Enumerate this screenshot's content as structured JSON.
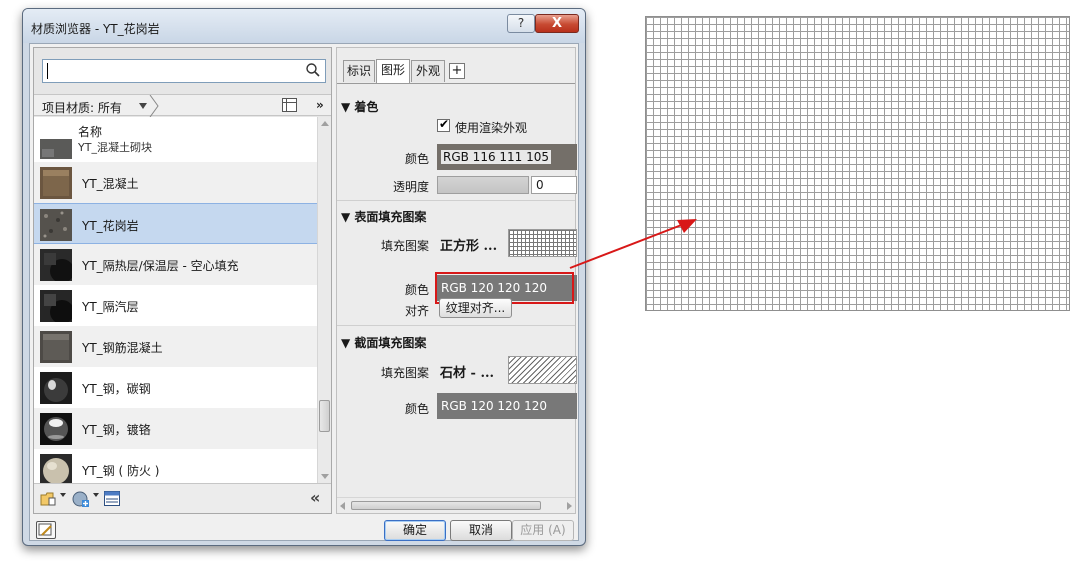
{
  "window": {
    "title": "材质浏览器 - YT_花岗岩",
    "help_label": "?",
    "close_label": "X"
  },
  "search": {
    "placeholder": "",
    "value": ""
  },
  "filter": {
    "label": "项目材质: 所有",
    "more": "»"
  },
  "list": {
    "header_name": "名称",
    "header_partial": "YT_混凝土砌块",
    "items": [
      {
        "label": "YT_混凝土",
        "thumb": "concrete-brown"
      },
      {
        "label": "YT_花岗岩",
        "thumb": "granite",
        "selected": true
      },
      {
        "label": "YT_隔热层/保温层 - 空心填充",
        "thumb": "insulation-dark"
      },
      {
        "label": "YT_隔汽层",
        "thumb": "vapor-dark"
      },
      {
        "label": "YT_钢筋混凝土",
        "thumb": "concrete-gray"
      },
      {
        "label": "YT_钢，碳钢",
        "thumb": "steel-sphere"
      },
      {
        "label": "YT_钢，镀铬",
        "thumb": "chrome-sphere"
      },
      {
        "label": "YT_钢 ( 防火 )",
        "thumb": "fireproof-sphere"
      }
    ]
  },
  "left_toolbar": {
    "collapse_label": "«"
  },
  "tabs": [
    {
      "label": "标识",
      "active": false
    },
    {
      "label": "图形",
      "active": true
    },
    {
      "label": "外观",
      "active": false
    }
  ],
  "tab_add_label": "+",
  "shading": {
    "title": "▼ 着色",
    "use_render_appearance": "使用渲染外观",
    "color_label": "颜色",
    "color_value": "RGB 116 111 105",
    "color_hex": "#746f69",
    "transparency_label": "透明度",
    "transparency_value": "0"
  },
  "surface_pattern": {
    "title": "▼ 表面填充图案",
    "pattern_label": "填充图案",
    "pattern_name": "正方形 ...",
    "color_label": "颜色",
    "color_value": "RGB 120 120 120",
    "align_label": "对齐",
    "align_button": "纹理对齐..."
  },
  "cut_pattern": {
    "title": "▼ 截面填充图案",
    "pattern_label": "填充图案",
    "pattern_name": "石材 - ...",
    "color_label": "颜色",
    "color_value": "RGB 120 120 120"
  },
  "buttons": {
    "ok": "确定",
    "cancel": "取消",
    "apply": "应用 (A)"
  },
  "colors": {
    "highlight_red": "#d81818",
    "selected_row": "#c5d8ef",
    "grid_line": "#9d9d9d"
  }
}
